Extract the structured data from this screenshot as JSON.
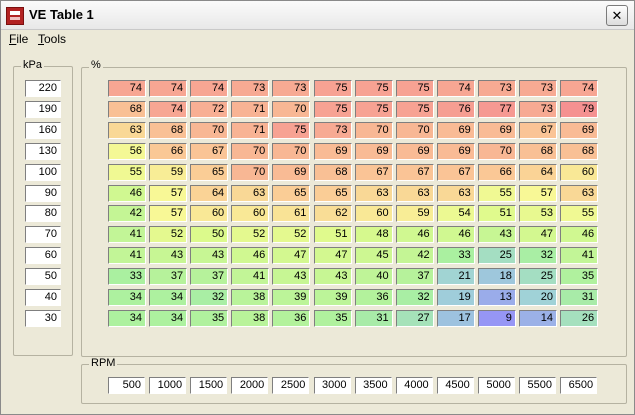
{
  "window": {
    "title": "VE Table 1",
    "close_label": "✕"
  },
  "menu": {
    "file_first": "F",
    "file_rest": "ile",
    "tools_first": "T",
    "tools_rest": "ools"
  },
  "kpa_group": {
    "label": "kPa",
    "values": [
      "220",
      "190",
      "160",
      "130",
      "100",
      "90",
      "80",
      "70",
      "60",
      "50",
      "40",
      "30"
    ]
  },
  "ve_group": {
    "label": "%"
  },
  "rpm_group": {
    "label": "RPM",
    "values": [
      "500",
      "1000",
      "1500",
      "2000",
      "2500",
      "3000",
      "3500",
      "4000",
      "4500",
      "5000",
      "5500",
      "6500"
    ]
  },
  "table": [
    [
      74,
      74,
      74,
      73,
      73,
      75,
      75,
      75,
      74,
      73,
      73,
      74
    ],
    [
      68,
      74,
      72,
      71,
      70,
      75,
      75,
      75,
      76,
      77,
      73,
      79
    ],
    [
      63,
      68,
      70,
      71,
      75,
      73,
      70,
      70,
      69,
      69,
      67,
      69
    ],
    [
      56,
      66,
      67,
      70,
      70,
      69,
      69,
      69,
      69,
      70,
      68,
      68
    ],
    [
      55,
      59,
      65,
      70,
      69,
      68,
      67,
      67,
      67,
      66,
      64,
      60
    ],
    [
      46,
      57,
      64,
      63,
      65,
      65,
      63,
      63,
      63,
      55,
      57,
      63
    ],
    [
      42,
      57,
      60,
      60,
      61,
      62,
      60,
      59,
      54,
      51,
      53,
      55
    ],
    [
      41,
      52,
      50,
      52,
      52,
      51,
      48,
      46,
      46,
      43,
      47,
      46
    ],
    [
      41,
      43,
      43,
      46,
      47,
      47,
      45,
      42,
      33,
      25,
      32,
      41
    ],
    [
      33,
      37,
      37,
      41,
      43,
      43,
      40,
      37,
      21,
      18,
      25,
      35
    ],
    [
      34,
      34,
      32,
      38,
      39,
      39,
      36,
      32,
      19,
      13,
      20,
      31
    ],
    [
      34,
      34,
      35,
      38,
      36,
      35,
      31,
      27,
      17,
      9,
      14,
      26
    ]
  ]
}
